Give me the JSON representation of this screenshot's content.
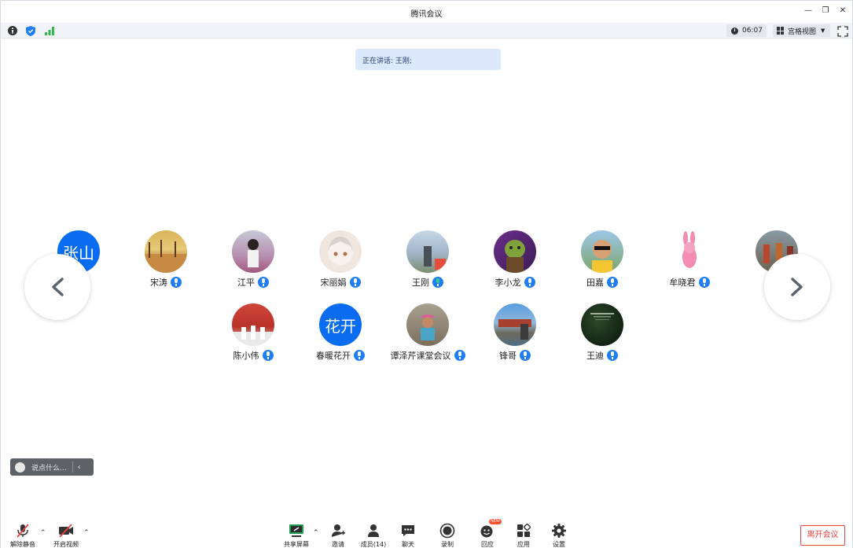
{
  "window": {
    "title": "腾讯会议"
  },
  "infobar": {
    "timer": "06:07",
    "view_label": "宫格视图"
  },
  "speaking": {
    "text": "正在讲话: 王刚;"
  },
  "participants": [
    {
      "name": "",
      "avatar_text": "张山",
      "avatar_color": "#0a6cf0"
    },
    {
      "name": "宋涛"
    },
    {
      "name": "江平"
    },
    {
      "name": "宋丽娟"
    },
    {
      "name": "王刚",
      "speaking": true
    },
    {
      "name": "李小龙"
    },
    {
      "name": "田嘉"
    },
    {
      "name": "牟晓君"
    },
    {
      "name": ""
    },
    {
      "name": "陈小伟"
    },
    {
      "name": "春暖花开",
      "avatar_text": "花开",
      "avatar_color": "#0a6cf0"
    },
    {
      "name": "谭泽芹课堂会议"
    },
    {
      "name": "锋哥"
    },
    {
      "name": "王迪"
    }
  ],
  "chat": {
    "placeholder": "说点什么..."
  },
  "toolbar": {
    "unmute": "解除静音",
    "start_video": "开启视频",
    "share_screen": "共享屏幕",
    "invite": "邀请",
    "members": "成员(14)",
    "chat": "聊天",
    "record": "录制",
    "reactions": "回应",
    "reactions_badge": "NEW",
    "apps": "应用",
    "settings": "设置",
    "leave": "离开会议"
  },
  "colors": {
    "accent": "#1f7ef5",
    "leave": "#e84545",
    "banner": "#dce8fb"
  }
}
